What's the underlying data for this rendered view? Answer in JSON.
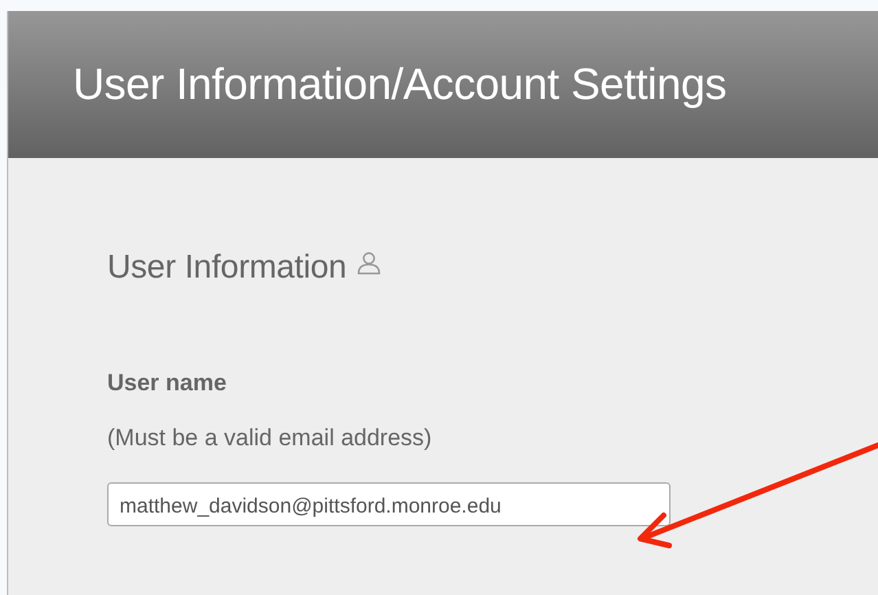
{
  "header": {
    "title": "User Information/Account Settings"
  },
  "section": {
    "heading": "User Information"
  },
  "fields": [
    {
      "label": "User name",
      "hint": "(Must be a valid email address)",
      "value": "matthew_davidson@pittsford.monroe.edu"
    }
  ]
}
